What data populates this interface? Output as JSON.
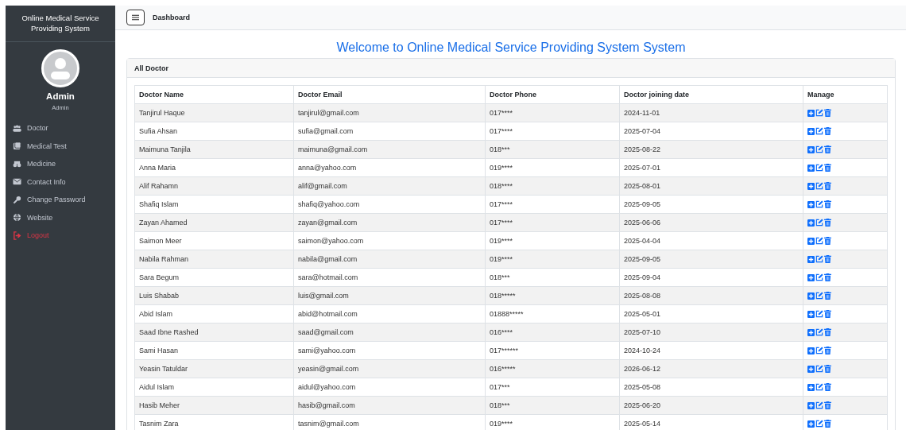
{
  "sidebar": {
    "title": "Online Medical Service Providing System",
    "user": {
      "name": "Admin",
      "role": "Admin"
    },
    "items": [
      {
        "label": "Doctor",
        "kind": "link"
      },
      {
        "label": "Medical Test",
        "kind": "link"
      },
      {
        "label": "Medicine",
        "kind": "link"
      },
      {
        "label": "Contact Info",
        "kind": "link"
      },
      {
        "label": "Change Password",
        "kind": "link"
      },
      {
        "label": "Website",
        "kind": "link"
      },
      {
        "label": "Logout",
        "kind": "logout"
      }
    ]
  },
  "topbar": {
    "title": "Dashboard"
  },
  "heading": "Welcome to Online Medical Service Providing System System",
  "card": {
    "title": "All Doctor",
    "table": {
      "columns": [
        "Doctor Name",
        "Doctor Email",
        "Doctor Phone",
        "Doctor joining date",
        "Manage"
      ],
      "rows": [
        [
          "Tanjirul Haque",
          "tanjirul@gmail.com",
          "017****",
          "2024-11-01"
        ],
        [
          "Sufia Ahsan",
          "sufia@gmail.com",
          "017****",
          "2025-07-04"
        ],
        [
          "Maimuna Tanjila",
          "maimuna@gmail.com",
          "018***",
          "2025-08-22"
        ],
        [
          "Anna Maria",
          "anna@yahoo.com",
          "019****",
          "2025-07-01"
        ],
        [
          "Alif Rahamn",
          "alif@gmail.com",
          "018****",
          "2025-08-01"
        ],
        [
          "Shafiq Islam",
          "shafiq@yahoo.com",
          "017****",
          "2025-09-05"
        ],
        [
          "Zayan Ahamed",
          "zayan@gmail.com",
          "017****",
          "2025-06-06"
        ],
        [
          "Saimon Meer",
          "saimon@yahoo.com",
          "019****",
          "2025-04-04"
        ],
        [
          "Nabila Rahman",
          "nabila@gmail.com",
          "019****",
          "2025-09-05"
        ],
        [
          "Sara Begum",
          "sara@hotmail.com",
          "018***",
          "2025-09-04"
        ],
        [
          "Luis Shabab",
          "luis@gmail.com",
          "018*****",
          "2025-08-08"
        ],
        [
          "Abid Islam",
          "abid@hotmail.com",
          "01888*****",
          "2025-05-01"
        ],
        [
          "Saad Ibne Rashed",
          "saad@gmail.com",
          "016****",
          "2025-07-10"
        ],
        [
          "Sami Hasan",
          "sami@yahoo.com",
          "017******",
          "2024-10-24"
        ],
        [
          "Yeasin Tatuldar",
          "yeasin@gmail.com",
          "016*****",
          "2026-06-12"
        ],
        [
          "Aidul Islam",
          "aidul@yahoo.com",
          "017***",
          "2025-05-08"
        ],
        [
          "Hasib Meher",
          "hasib@gmail.com",
          "018***",
          "2025-06-20"
        ],
        [
          "Tasnim Zara",
          "tasnim@gmail.com",
          "019****",
          "2025-05-14"
        ]
      ]
    }
  }
}
